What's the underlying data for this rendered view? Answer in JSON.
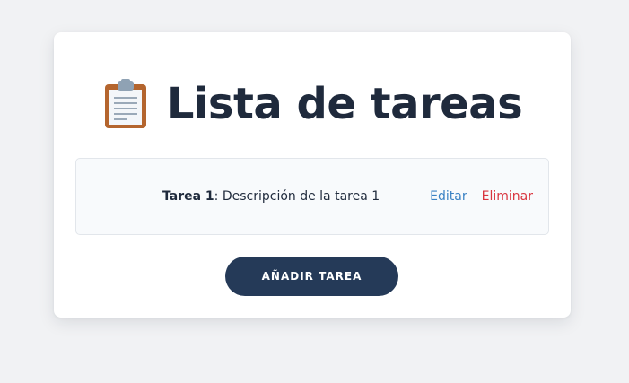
{
  "header": {
    "title": "Lista de tareas",
    "icon": "clipboard-icon"
  },
  "tasks": [
    {
      "name": "Tarea 1",
      "separator": ": ",
      "description": "Descripción de la tarea 1",
      "edit_label": "Editar",
      "delete_label": "Eliminar"
    }
  ],
  "actions": {
    "add_label": "AÑADIR TAREA"
  },
  "colors": {
    "background": "#f1f2f4",
    "title": "#1f2a3c",
    "edit_link": "#3b82c4",
    "delete_link": "#d9343e",
    "button": "#253a58"
  }
}
